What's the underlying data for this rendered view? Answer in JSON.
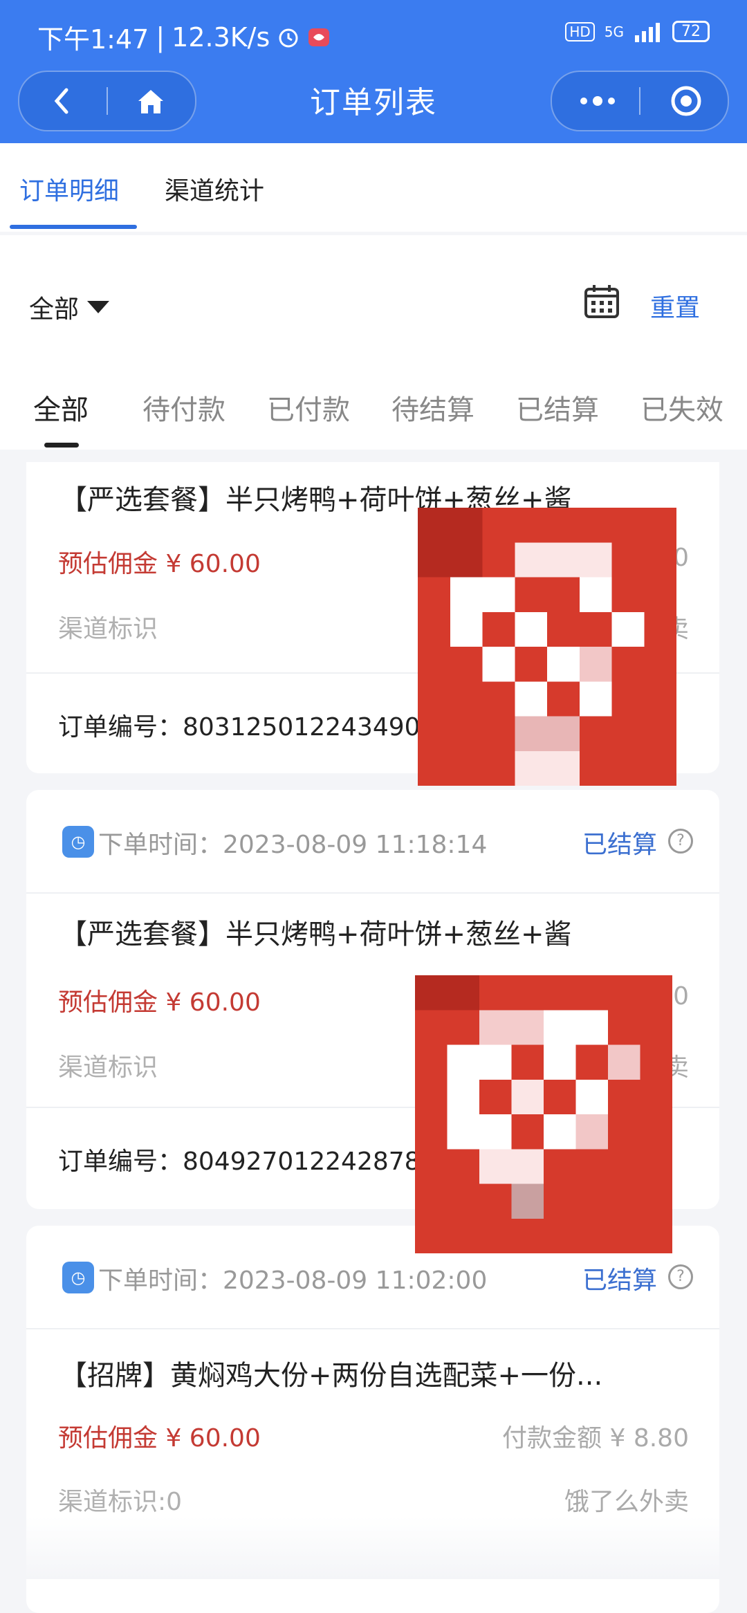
{
  "status_bar": {
    "time": "下午1:47",
    "speed": "12.3K/s",
    "battery": "72",
    "network": "5G",
    "hd": "HD"
  },
  "nav": {
    "title": "订单列表"
  },
  "subtabs": [
    {
      "label": "订单明细"
    },
    {
      "label": "渠道统计"
    }
  ],
  "filter": {
    "selected": "全部",
    "reset": "重置"
  },
  "status_tabs": [
    {
      "label": "全部"
    },
    {
      "label": "待付款"
    },
    {
      "label": "已付款"
    },
    {
      "label": "待结算"
    },
    {
      "label": "已结算"
    },
    {
      "label": "已失效"
    }
  ],
  "orders": [
    {
      "title": "【严选套餐】半只烤鸭+荷叶饼+葱丝+酱",
      "commission": "预估佣金 ¥ 60.00",
      "amount_fragment": "0",
      "channel": "渠道标识",
      "platform_fragment": "卖",
      "order_no": "订单编号：803125012243490"
    },
    {
      "time": "下单时间：2023-08-09 11:18:14",
      "status": "已结算",
      "title": "【严选套餐】半只烤鸭+荷叶饼+葱丝+酱",
      "commission": "预估佣金 ¥ 60.00",
      "amount_fragment": "0",
      "channel": "渠道标识",
      "platform_fragment": "卖",
      "order_no": "订单编号：804927012242878"
    },
    {
      "time": "下单时间：2023-08-09 11:02:00",
      "status": "已结算",
      "title": "【招牌】黄焖鸡大份+两份自选配菜+一份...",
      "commission": "预估佣金 ¥ 60.00",
      "amount": "付款金额 ¥ 8.80",
      "channel": "渠道标识:0",
      "platform": "饿了么外卖"
    }
  ],
  "colors": {
    "primary": "#3b7cf0",
    "commission": "#c43a33",
    "status": "#3b6fd0"
  }
}
